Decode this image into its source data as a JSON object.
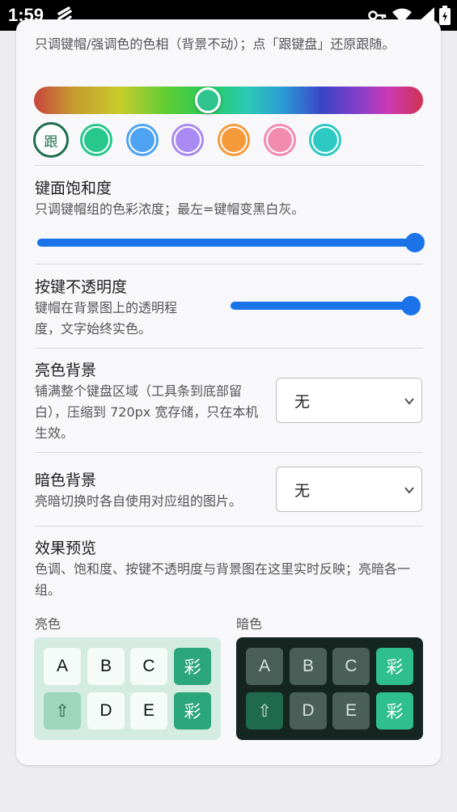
{
  "status_bar": {
    "time": "1:59"
  },
  "hue_section": {
    "description": "只调键帽/强调色的色相（背景不动）；点「跟键盘」还原跟随。",
    "follow_label": "跟",
    "swatches": [
      "#26c88c",
      "#4ea3f2",
      "#a98af2",
      "#f59a3a",
      "#f28cae",
      "#2ec9c2"
    ],
    "thumb_color": "#2fc48e"
  },
  "saturation": {
    "title": "键面饱和度",
    "description": "只调键帽组的色彩浓度；最左=键帽变黑白灰。",
    "value": 1.0
  },
  "opacity": {
    "title": "按键不透明度",
    "description": "键帽在背景图上的透明程度，文字始终实色。",
    "value": 1.0
  },
  "light_bg": {
    "title": "亮色背景",
    "description": "铺满整个键盘区域（工具条到底部留白），压缩到 720px 宽存储，只在本机生效。",
    "selected": "无"
  },
  "dark_bg": {
    "title": "暗色背景",
    "description": "亮暗切换时各自使用对应组的图片。",
    "selected": "无"
  },
  "preview": {
    "title": "效果预览",
    "description": "色调、饱和度、按键不透明度与背景图在这里实时反映；亮暗各一组。",
    "light_label": "亮色",
    "dark_label": "暗色",
    "keys_row1": [
      "A",
      "B",
      "C",
      "彩"
    ],
    "keys_row2": [
      "⇧",
      "D",
      "E",
      "彩"
    ],
    "accent": "#2aa57c"
  }
}
